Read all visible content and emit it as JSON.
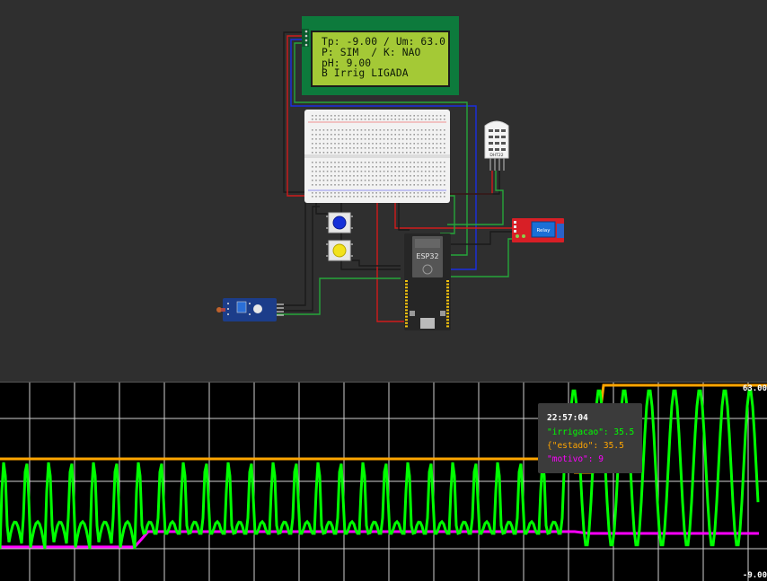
{
  "lcd": {
    "line1": "Tp: -9.00 / Um: 63.0",
    "line2": "P: SIM  / K: NAO",
    "line3": "pH: 9.00",
    "line4": "B Irrig LIGADA"
  },
  "components": {
    "mcu_label": "ESP32",
    "sensor_label": "DHT22",
    "relay_label": "Relay"
  },
  "plotter": {
    "ymax_label": "63.00",
    "ymin_label": "-9.00",
    "colors": {
      "irrigacao": "#00ff00",
      "estado": "#ffa500",
      "motivo": "#ff00ff"
    },
    "tooltip": {
      "time": "22:57:04",
      "series1": "\"irrigacao\": 35.5",
      "series2": "{\"estado\": 35.5",
      "series3": "\"motivo\": 9"
    }
  }
}
